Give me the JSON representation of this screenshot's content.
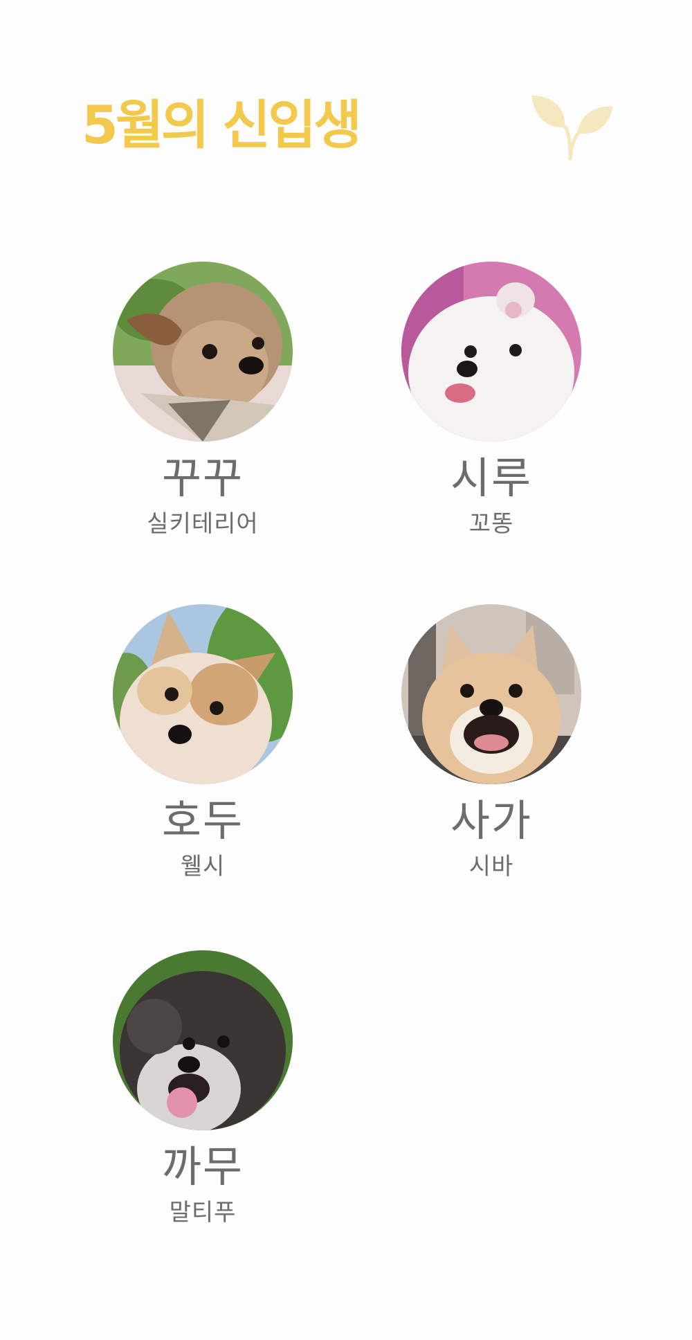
{
  "header": {
    "title": "5월의 신입생",
    "title_color": "#F2C94C",
    "leaf_color": "#F6E8BE"
  },
  "members": [
    {
      "name": "꾸꾸",
      "breed": "실키테리어",
      "icon": "yorkie-dog-photo"
    },
    {
      "name": "시루",
      "breed": "꼬똥",
      "icon": "white-fluffy-dog-photo"
    },
    {
      "name": "호두",
      "breed": "웰시",
      "icon": "corgi-dog-photo"
    },
    {
      "name": "사가",
      "breed": "시바",
      "icon": "shiba-dog-photo"
    },
    {
      "name": "까무",
      "breed": "말티푸",
      "icon": "maltipoo-dog-photo"
    }
  ]
}
